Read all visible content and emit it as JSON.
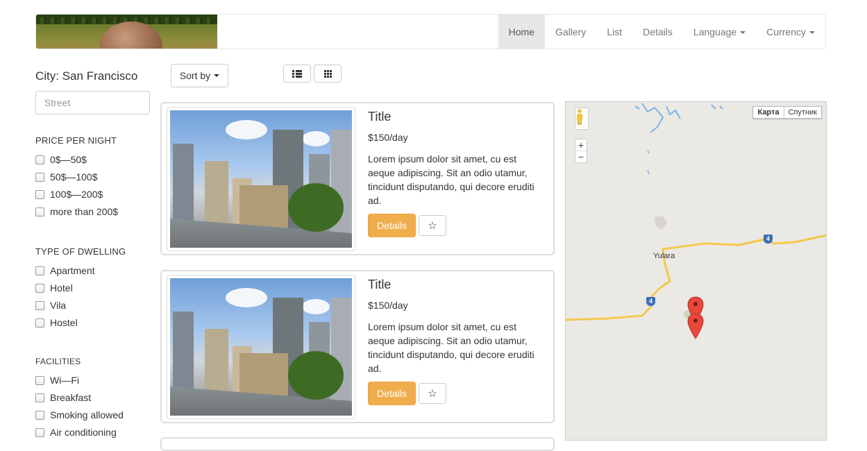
{
  "navbar": {
    "items": [
      {
        "label": "Home",
        "active": true
      },
      {
        "label": "Gallery"
      },
      {
        "label": "List"
      },
      {
        "label": "Details"
      },
      {
        "label": "Language",
        "dropdown": true
      },
      {
        "label": "Currency",
        "dropdown": true
      }
    ]
  },
  "sidebar": {
    "city": "City: San Francisco",
    "street_placeholder": "Street",
    "price": {
      "title": "PRICE PER NIGHT",
      "options": [
        "0$—50$",
        "50$—100$",
        "100$—200$",
        "more than 200$"
      ]
    },
    "dwelling": {
      "title": "TYPE OF DWELLING",
      "options": [
        "Apartment",
        "Hotel",
        "Vila",
        "Hostel"
      ]
    },
    "facilities": {
      "title": "FACILITIES",
      "options": [
        "Wi—Fi",
        "Breakfast",
        "Smoking allowed",
        "Air conditioning"
      ]
    }
  },
  "toolbar": {
    "sort_label": "Sort by",
    "list_view_icon": "list-icon",
    "grid_view_icon": "grid-icon"
  },
  "listings": [
    {
      "title": "Title",
      "price": "$150/day",
      "description": "Lorem ipsum dolor sit amet, cu est aeque adipiscing. Sit an odio utamur, tincidunt disputando, qui decore eruditi ad.",
      "details_label": "Details",
      "favorite_icon": "star-icon"
    },
    {
      "title": "Title",
      "price": "$150/day",
      "description": "Lorem ipsum dolor sit amet, cu est aeque adipiscing. Sit an odio utamur, tincidunt disputando, qui decore eruditi ad.",
      "details_label": "Details",
      "favorite_icon": "star-icon"
    }
  ],
  "map": {
    "type_map": "Карта",
    "type_satellite": "Спутник",
    "zoom_in": "+",
    "zoom_out": "−",
    "place_label": "Yulara",
    "route_number": "4",
    "colors": {
      "road": "#f2c94c",
      "marker": "#e8473b",
      "water": "#7fb3e6",
      "background": "#ebe9e4"
    }
  },
  "colors": {
    "accent": "#f0ad4e",
    "nav_active_bg": "#e7e7e7"
  }
}
